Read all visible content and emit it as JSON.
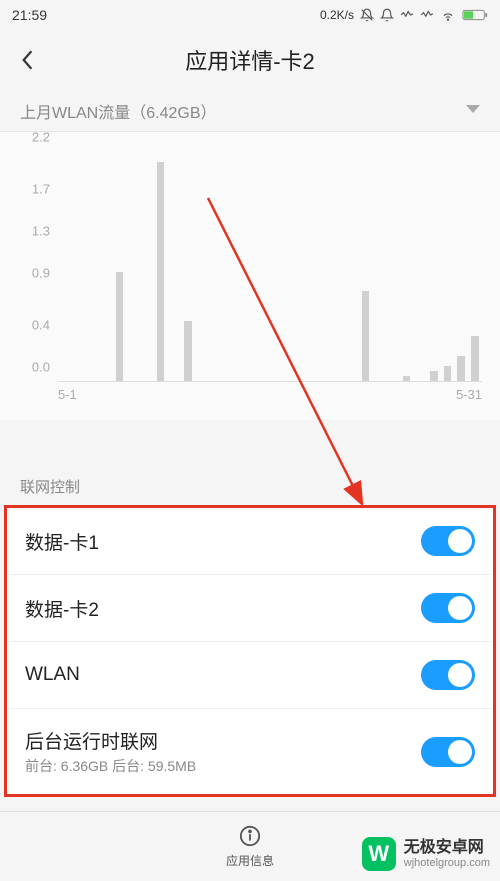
{
  "status": {
    "time": "21:59",
    "net_speed": "0.2K/s"
  },
  "header": {
    "title": "应用详情-卡2"
  },
  "dropdown": {
    "label": "上月WLAN流量（6.42GB）"
  },
  "chart_data": {
    "type": "bar",
    "title": "",
    "xlabel": "",
    "ylabel": "",
    "ylim": [
      0,
      2.2
    ],
    "y_ticks": [
      0.0,
      0.4,
      0.9,
      1.3,
      1.7,
      2.2
    ],
    "x_ticks": [
      "5-1",
      "5-31"
    ],
    "categories": [
      "5-1",
      "5-2",
      "5-3",
      "5-4",
      "5-5",
      "5-6",
      "5-7",
      "5-8",
      "5-9",
      "5-10",
      "5-11",
      "5-12",
      "5-13",
      "5-14",
      "5-15",
      "5-16",
      "5-17",
      "5-18",
      "5-19",
      "5-20",
      "5-21",
      "5-22",
      "5-23",
      "5-24",
      "5-25",
      "5-26",
      "5-27",
      "5-28",
      "5-29",
      "5-30",
      "5-31"
    ],
    "values": [
      0.0,
      0.0,
      0.0,
      0.0,
      1.1,
      0.0,
      0.0,
      2.2,
      0.0,
      0.6,
      0.0,
      0.0,
      0.0,
      0.0,
      0.0,
      0.0,
      0.0,
      0.0,
      0.0,
      0.0,
      0.0,
      0.0,
      0.9,
      0.0,
      0.0,
      0.05,
      0.0,
      0.1,
      0.15,
      0.25,
      0.45
    ]
  },
  "network_section": {
    "header": "联网控制",
    "toggles": [
      {
        "label": "数据-卡1",
        "on": true
      },
      {
        "label": "数据-卡2",
        "on": true
      },
      {
        "label": "WLAN",
        "on": true
      },
      {
        "label": "后台运行时联网",
        "sub": "前台: 6.36GB  后台: 59.5MB",
        "on": true
      }
    ]
  },
  "bottom_nav": {
    "label": "应用信息"
  },
  "watermark": {
    "main": "无极安卓网",
    "sub": "wjhotelgroup.com"
  }
}
